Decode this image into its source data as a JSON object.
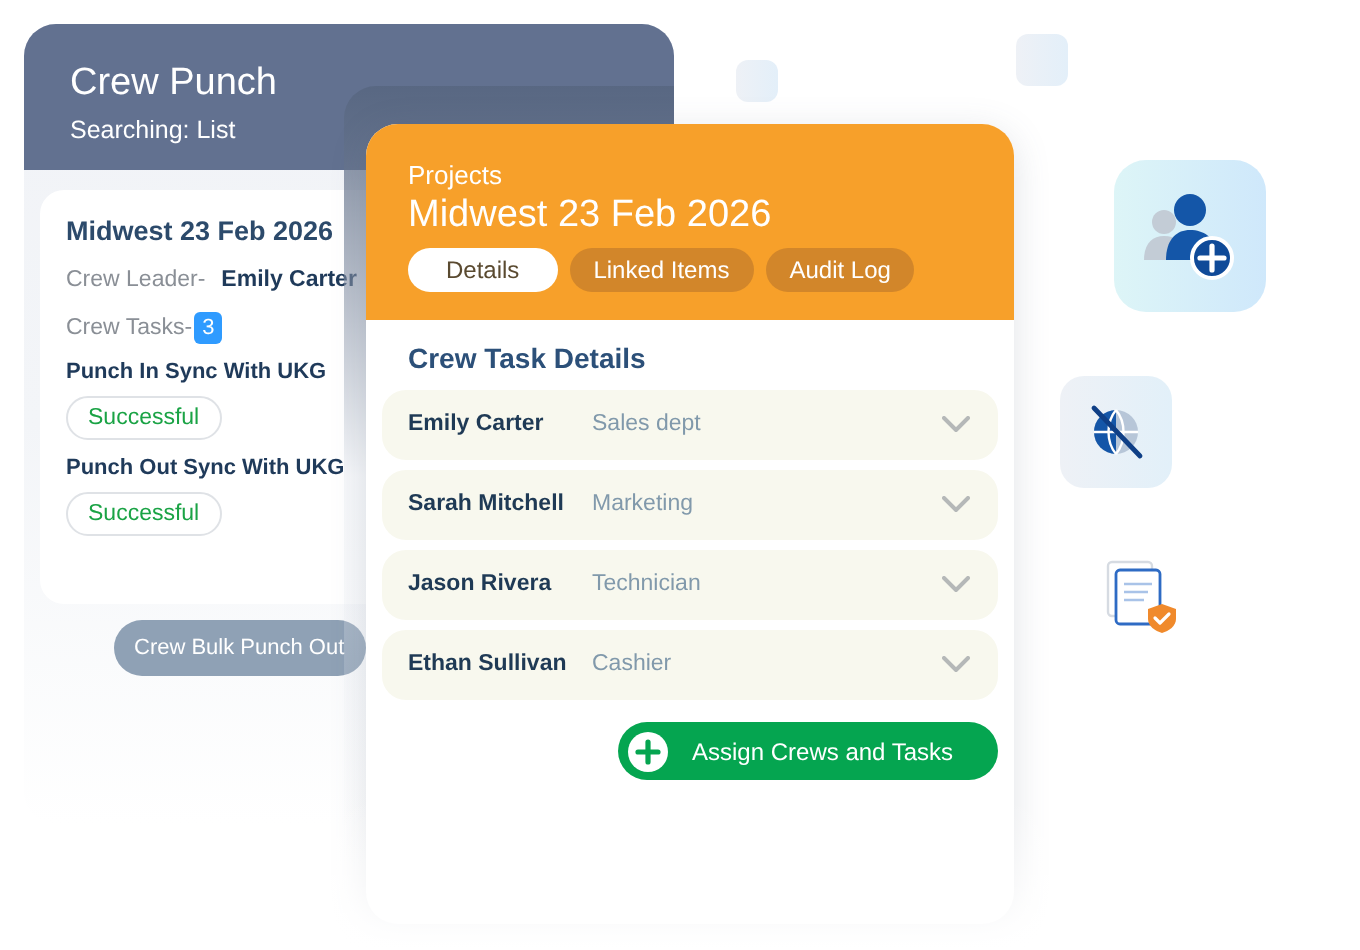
{
  "back_card": {
    "title": "Crew Punch",
    "subtitle": "Searching: List",
    "project": {
      "title": "Midwest 23 Feb 2026",
      "crew_leader_label": "Crew Leader-",
      "crew_leader": "Emily Carter",
      "crew_tasks_label": "Crew Tasks-",
      "crew_tasks_count": "3",
      "syncs": [
        {
          "label": "Punch In Sync With UKG",
          "status": "Successful"
        },
        {
          "label": "Punch Out Sync With UKG",
          "status": "Successful"
        }
      ]
    },
    "button": "Crew Bulk Punch Out"
  },
  "front_card": {
    "breadcrumb": "Projects",
    "title": "Midwest 23 Feb 2026",
    "tabs": [
      {
        "label": "Details",
        "selected": true
      },
      {
        "label": "Linked Items",
        "selected": false
      },
      {
        "label": "Audit Log",
        "selected": false
      }
    ],
    "section_title": "Crew Task Details",
    "crew": [
      {
        "name": "Emily Carter",
        "department": "Sales dept"
      },
      {
        "name": "Sarah Mitchell",
        "department": "Marketing"
      },
      {
        "name": "Jason Rivera",
        "department": "Technician"
      },
      {
        "name": "Ethan Sullivan",
        "department": "Cashier"
      }
    ],
    "button": "Assign Crews and Tasks"
  }
}
